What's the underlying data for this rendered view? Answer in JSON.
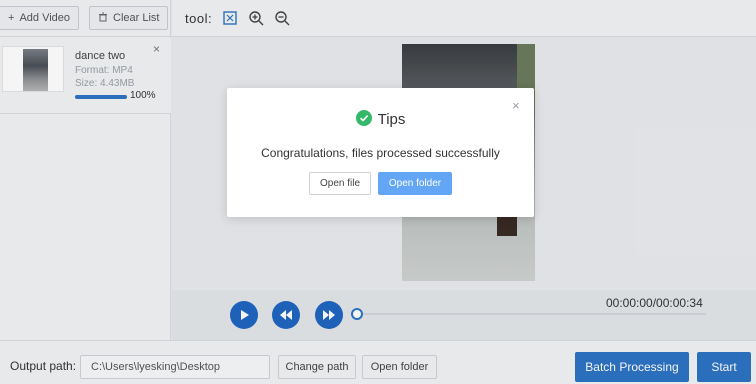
{
  "sidebar": {
    "add_video_label": "Add Video",
    "clear_list_label": "Clear List",
    "file": {
      "name": "dance two",
      "format": "Format:  MP4",
      "size": "Size:  4.43MB",
      "progress_percent": "100%",
      "progress_value": 1.0
    }
  },
  "toolbar": {
    "label": "tool:"
  },
  "player": {
    "time": "00:00:00/00:00:34"
  },
  "bottom": {
    "output_label": "Output path:",
    "path_value": "C:\\Users\\lyesking\\Desktop",
    "change_path_label": "Change path",
    "open_folder_label": "Open folder",
    "batch_label": "Batch Processing",
    "start_label": "Start"
  },
  "dialog": {
    "title": "Tips",
    "message": "Congratulations, files processed successfully",
    "open_file_label": "Open file",
    "open_folder_label": "Open folder"
  },
  "colors": {
    "primary": "#2d74c4",
    "dialog_primary": "#63a6f5",
    "success": "#34b96b"
  }
}
